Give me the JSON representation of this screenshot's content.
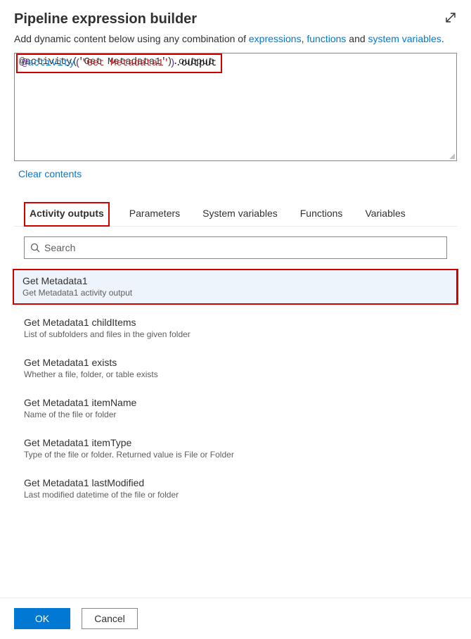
{
  "header": {
    "title": "Pipeline expression builder",
    "helper_prefix": "Add dynamic content below using any combination of ",
    "link1": "expressions",
    "link_sep1": ", ",
    "link2": "functions",
    "link_sep2": " and ",
    "link3": "system variables",
    "helper_suffix": "."
  },
  "editor": {
    "value": "@activity('Get Metadata1').output",
    "tokens": {
      "at": "@",
      "fn": "activity",
      "lparen": "(",
      "str": "'Get Metadata1'",
      "rparen": ")",
      "dot": ".",
      "prop": "output"
    }
  },
  "clear_label": "Clear contents",
  "tabs": {
    "activity_outputs": "Activity outputs",
    "parameters": "Parameters",
    "system_variables": "System variables",
    "functions": "Functions",
    "variables": "Variables"
  },
  "search": {
    "placeholder": "Search"
  },
  "items": [
    {
      "title": "Get Metadata1",
      "desc": "Get Metadata1 activity output",
      "selected": true
    },
    {
      "title": "Get Metadata1 childItems",
      "desc": "List of subfolders and files in the given folder",
      "selected": false
    },
    {
      "title": "Get Metadata1 exists",
      "desc": "Whether a file, folder, or table exists",
      "selected": false
    },
    {
      "title": "Get Metadata1 itemName",
      "desc": "Name of the file or folder",
      "selected": false
    },
    {
      "title": "Get Metadata1 itemType",
      "desc": "Type of the file or folder. Returned value is File or Folder",
      "selected": false
    },
    {
      "title": "Get Metadata1 lastModified",
      "desc": "Last modified datetime of the file or folder",
      "selected": false
    }
  ],
  "buttons": {
    "ok": "OK",
    "cancel": "Cancel"
  }
}
